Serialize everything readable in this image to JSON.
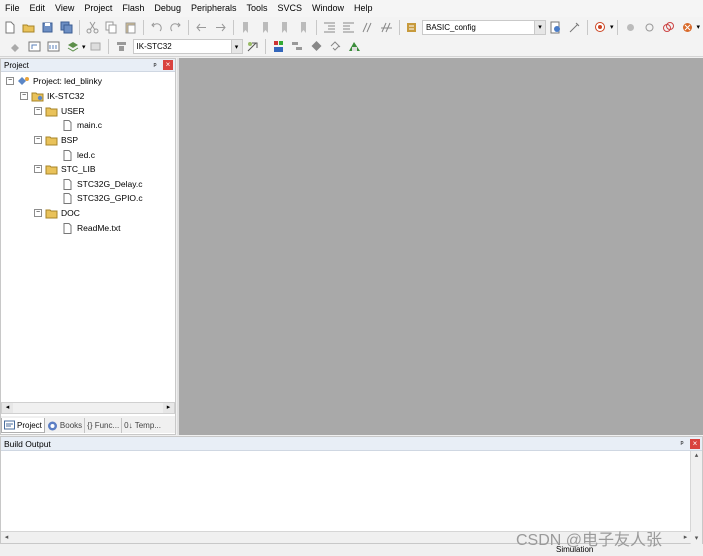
{
  "menu": [
    "File",
    "Edit",
    "View",
    "Project",
    "Flash",
    "Debug",
    "Peripherals",
    "Tools",
    "SVCS",
    "Window",
    "Help"
  ],
  "toolbar": {
    "config_dropdown": "BASIC_config",
    "target_dropdown": "IK-STC32"
  },
  "project_panel": {
    "title": "Project",
    "pin_glyph": "ᵖ",
    "close_glyph": "×",
    "tree": [
      {
        "label": "Project: led_blinky",
        "type": "project",
        "expanded": true
      },
      {
        "label": "IK-STC32",
        "type": "target",
        "expanded": true
      },
      {
        "label": "USER",
        "type": "folder",
        "expanded": true
      },
      {
        "label": "main.c",
        "type": "file"
      },
      {
        "label": "BSP",
        "type": "folder",
        "expanded": true
      },
      {
        "label": "led.c",
        "type": "file"
      },
      {
        "label": "STC_LIB",
        "type": "folder",
        "expanded": true
      },
      {
        "label": "STC32G_Delay.c",
        "type": "file"
      },
      {
        "label": "STC32G_GPIO.c",
        "type": "file"
      },
      {
        "label": "DOC",
        "type": "folder",
        "expanded": true
      },
      {
        "label": "ReadMe.txt",
        "type": "file"
      }
    ],
    "tabs": [
      "Project",
      "Books",
      "{} Func...",
      "0↓ Temp..."
    ]
  },
  "build_output": {
    "title": "Build Output",
    "content": ""
  },
  "status": {
    "mode": "Simulation"
  },
  "watermark": "CSDN @电子友人张",
  "colors": {
    "editor_bg": "#a9a9a9",
    "panel_header": "#e8eef6",
    "close": "#d9433f"
  }
}
